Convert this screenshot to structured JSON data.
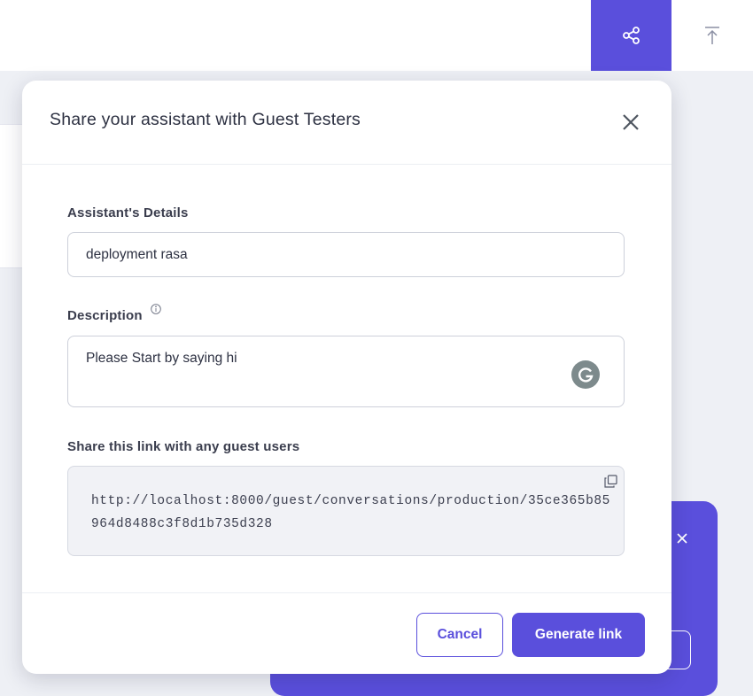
{
  "header": {
    "share_icon": "share-nodes-icon",
    "upload_icon": "upload-arrow-icon",
    "accent": "#5a4fdc"
  },
  "modal": {
    "title": "Share your assistant with Guest Testers",
    "close_icon": "close-icon",
    "assistant_label": "Assistant's Details",
    "assistant_value": "deployment rasa",
    "description_label": "Description",
    "description_value": "Please Start by saying hi",
    "info_icon": "info-icon",
    "grammarly_icon": "grammarly-icon",
    "link_label": "Share this link with any guest users",
    "link_value": "http://localhost:8000/guest/conversations/production/35ce365b85964d8488c3f8d1b735d328",
    "copy_icon": "copy-icon",
    "cancel_label": "Cancel",
    "generate_label": "Generate link"
  },
  "toast": {
    "close_icon": "close-icon"
  }
}
